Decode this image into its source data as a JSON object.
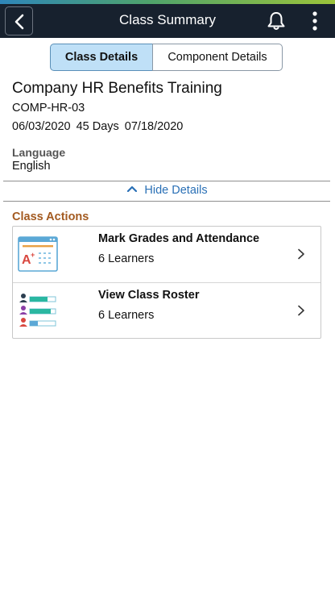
{
  "header": {
    "title": "Class Summary",
    "back_icon": "chevron-left-icon",
    "bell_icon": "bell-icon",
    "more_icon": "more-vertical-icon"
  },
  "tabs": [
    {
      "label": "Class Details",
      "active": true
    },
    {
      "label": "Component Details",
      "active": false
    }
  ],
  "class_info": {
    "title": "Company HR Benefits Training",
    "code": "COMP-HR-03",
    "start_date": "06/03/2020",
    "duration": "45 Days",
    "end_date": "07/18/2020",
    "language_label": "Language",
    "language_value": "English"
  },
  "hide_details_label": "Hide Details",
  "section": {
    "title": "Class Actions",
    "items": [
      {
        "title": "Mark Grades and Attendance",
        "subtitle": "6 Learners",
        "icon": "grades-icon"
      },
      {
        "title": "View Class Roster",
        "subtitle": "6 Learners",
        "icon": "roster-icon"
      }
    ]
  },
  "colors": {
    "header_bg": "#17212e",
    "active_tab": "#bfe0f7",
    "link": "#2a70b6",
    "section_title": "#a35a20"
  }
}
